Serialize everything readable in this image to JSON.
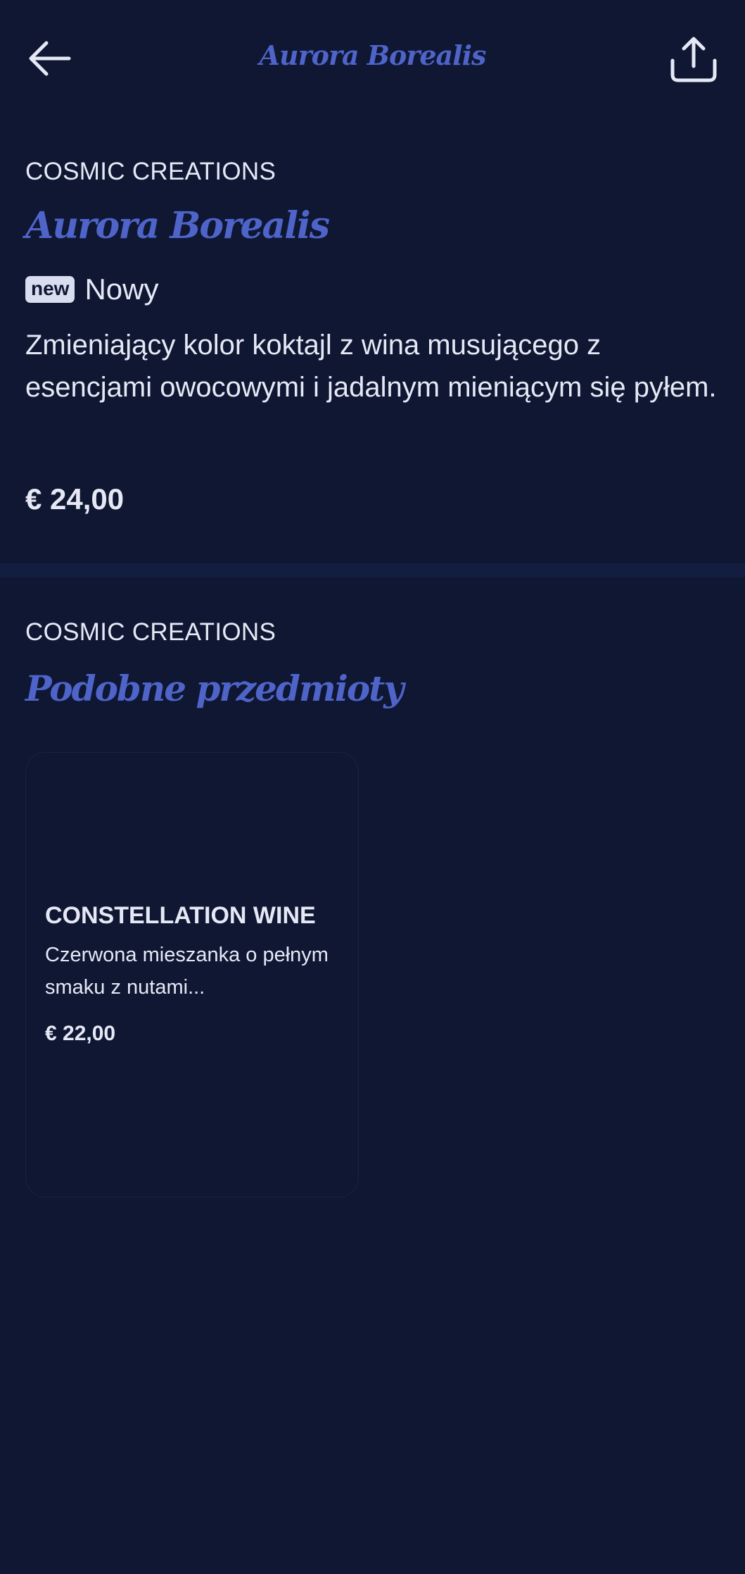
{
  "header": {
    "title": "Aurora Borealis",
    "back_icon": "arrow-left-icon",
    "share_icon": "share-icon"
  },
  "product": {
    "brand": "COSMIC CREATIONS",
    "name": "Aurora Borealis",
    "badge": "new",
    "badge_label": "Nowy",
    "description": "Zmieniający kolor koktajl z wina musującego z esencjami owocowymi i jadalnym mieniącym się pyłem.",
    "price": "€ 24,00"
  },
  "similar": {
    "brand": "COSMIC CREATIONS",
    "heading": "Podobne przedmioty",
    "items": [
      {
        "title": "CONSTELLATION WINE",
        "description": "Czerwona mieszanka o pełnym smaku z nutami...",
        "price": "€ 22,00"
      }
    ]
  },
  "colors": {
    "background": "#0f1733",
    "accent": "#4e64c9",
    "text": "#e6e9f5"
  }
}
